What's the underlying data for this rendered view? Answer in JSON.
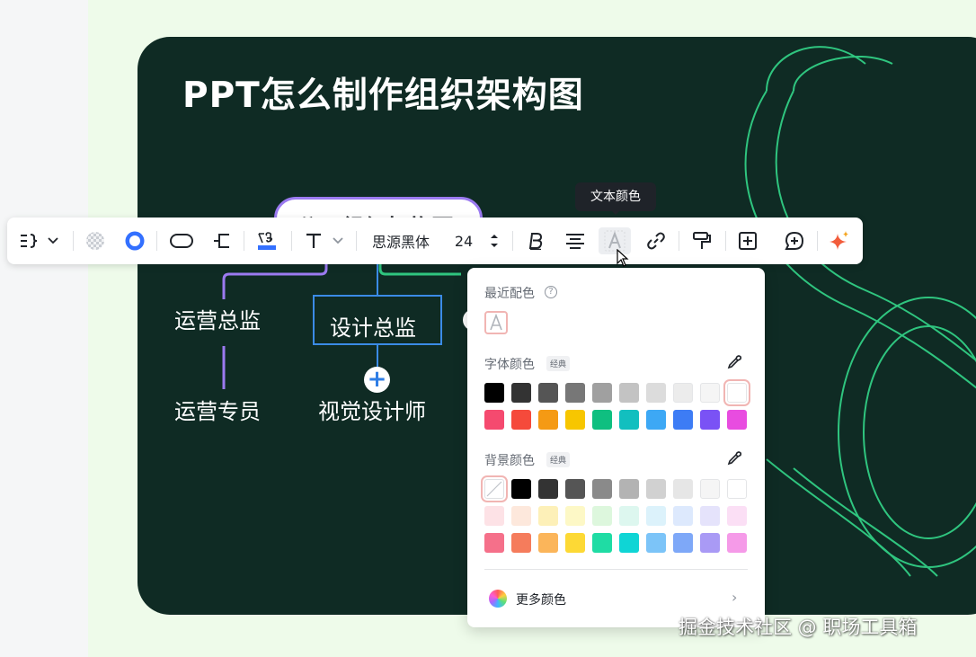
{
  "slide": {
    "title": "PPT怎么制作组织架构图",
    "root_node": "公司组织架构图",
    "nodes": {
      "ops_director": "运营总监",
      "design_director": "设计总监",
      "ops_specialist": "运营专员",
      "visual_designer": "视觉设计师"
    },
    "add_node_symbol": "+"
  },
  "toolbar": {
    "font_family": "思源黑体",
    "font_size": "24",
    "icons": [
      "structure-icon",
      "chevron-down-icon",
      "fill-none-icon",
      "border-color-icon",
      "shape-rounded-icon",
      "connector-icon",
      "text-style-icon",
      "text-icon",
      "bold-icon",
      "align-center-icon",
      "text-color-icon",
      "link-icon",
      "format-painter-icon",
      "insert-icon",
      "comment-icon",
      "ai-sparkle-icon"
    ]
  },
  "tooltip": {
    "text": "文本颜色"
  },
  "color_panel": {
    "recent_label": "最近配色",
    "font_color_label": "字体颜色",
    "font_color_badge": "经典",
    "background_color_label": "背景颜色",
    "background_color_badge": "经典",
    "more_colors_label": "更多颜色",
    "font_colors": [
      [
        "#000000",
        "#333333",
        "#555555",
        "#777777",
        "#a0a0a0",
        "#c3c3c3",
        "#dcdcdc",
        "#ececec",
        "#f5f5f5",
        "#ffffff"
      ],
      [
        "#f54a6f",
        "#f54a3b",
        "#f59a14",
        "#f7c600",
        "#0fbf80",
        "#12bfbf",
        "#3da8f5",
        "#3d7cf5",
        "#7a52f5",
        "#e84ce0"
      ]
    ],
    "background_colors": [
      [
        "none",
        "#000000",
        "#333333",
        "#555555",
        "#8a8a8a",
        "#b3b3b3",
        "#d1d1d1",
        "#e6e6e6",
        "#f5f5f5",
        "#ffffff"
      ],
      [
        "#fde2e6",
        "#fde8dc",
        "#fdf0b8",
        "#fdf8c6",
        "#ddf7dd",
        "#ddf7ef",
        "#dcf2fb",
        "#dde9fd",
        "#e5e3fb",
        "#fbdff5"
      ],
      [
        "#f5708a",
        "#f57c5c",
        "#fbb55a",
        "#fdd935",
        "#1fdca4",
        "#0fd5d5",
        "#7cc4f8",
        "#7ea8f8",
        "#a99af5",
        "#f59ae8"
      ]
    ]
  },
  "watermark": "掘金技术社区 @ 职场工具箱"
}
